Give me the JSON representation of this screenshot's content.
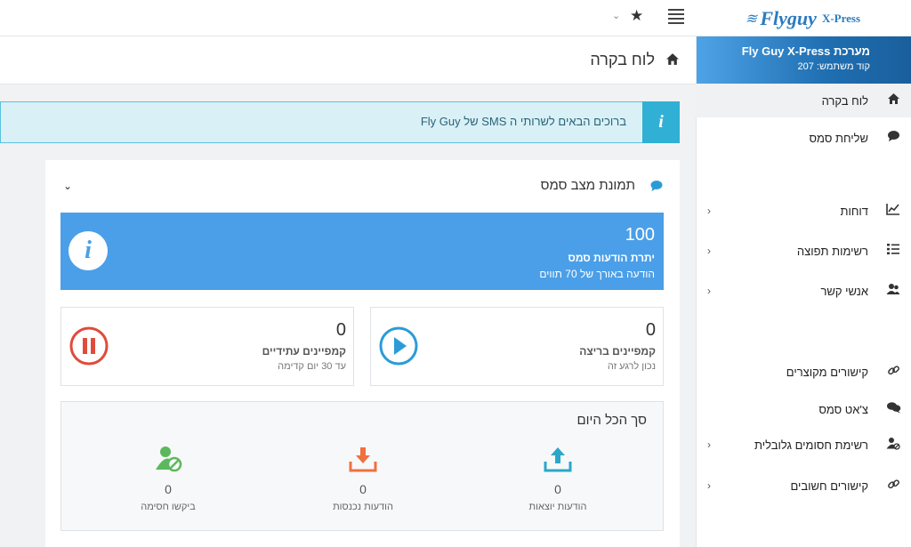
{
  "app": {
    "logo_text": "Flyguy",
    "logo_sub": "X-Press"
  },
  "profile": {
    "title": "מערכת Fly Guy X-Press",
    "code_label": "קוד משתמש: 207"
  },
  "page": {
    "title": "לוח בקרה"
  },
  "alert": {
    "text": "ברוכים הבאים לשרותי ה SMS של Fly Guy",
    "icon": "i"
  },
  "sidebar": {
    "items": [
      {
        "label": "לוח בקרה",
        "icon": "home-icon",
        "chevron": false,
        "active": true
      },
      {
        "label": "שליחת סמס",
        "icon": "comment-icon",
        "chevron": false
      },
      {
        "label": "דוחות",
        "icon": "chart-icon",
        "chevron": true
      },
      {
        "label": "רשימות תפוצה",
        "icon": "list-icon",
        "chevron": true
      },
      {
        "label": "אנשי קשר",
        "icon": "contacts-icon",
        "chevron": true
      },
      {
        "label": "קישורים מקוצרים",
        "icon": "link-icon",
        "chevron": false
      },
      {
        "label": "צ'אט סמס",
        "icon": "chat-icon",
        "chevron": false
      },
      {
        "label": "רשימת חסומים גלובלית",
        "icon": "user-block-icon",
        "chevron": true
      },
      {
        "label": "קישורים חשובים",
        "icon": "link-icon",
        "chevron": true
      }
    ]
  },
  "panel": {
    "title": "תמונת מצב סמס",
    "credits": {
      "value": "100",
      "label": "יתרת הודעות סמס",
      "sub": "הודעה באורך של 70 תווים"
    },
    "running": {
      "value": "0",
      "label": "קמפיינים בריצה",
      "sub": "נכון לרגע זה"
    },
    "future": {
      "value": "0",
      "label": "קמפיינים עתידיים",
      "sub": "עד 30 יום קדימה"
    },
    "summary": {
      "title": "סך הכל היום",
      "outgoing": {
        "value": "0",
        "label": "הודעות יוצאות"
      },
      "incoming": {
        "value": "0",
        "label": "הודעות נכנסות"
      },
      "blocks": {
        "value": "0",
        "label": "ביקשו חסימה"
      }
    }
  },
  "colors": {
    "accent": "#4a9fe8",
    "info": "#31b0d5",
    "play": "#2b9bd8",
    "pause": "#e04b3b",
    "upload": "#2aa7c9",
    "download": "#f07040",
    "block": "#5cb85c"
  }
}
